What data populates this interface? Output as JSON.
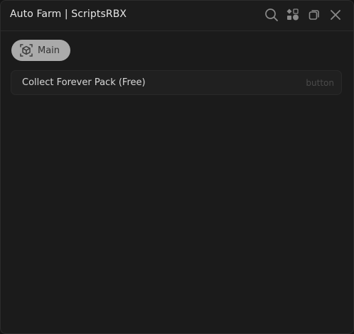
{
  "window": {
    "title": "Auto Farm | ScriptsRBX",
    "actions": [
      {
        "icon": "search-icon"
      },
      {
        "icon": "shapes-icon"
      },
      {
        "icon": "minimize-icon"
      },
      {
        "icon": "close-icon"
      }
    ]
  },
  "tabs": [
    {
      "label": "Main",
      "icon": "box-icon",
      "selected": true
    }
  ],
  "elements": [
    {
      "label": "Collect Forever Pack (Free)",
      "type": "button"
    }
  ],
  "colors": {
    "background": "#1b1b1b",
    "tab_selected": "#aaaaaa",
    "row_background": "#202020",
    "text": "#d8d8d8",
    "muted_text": "#4a4a4a"
  }
}
